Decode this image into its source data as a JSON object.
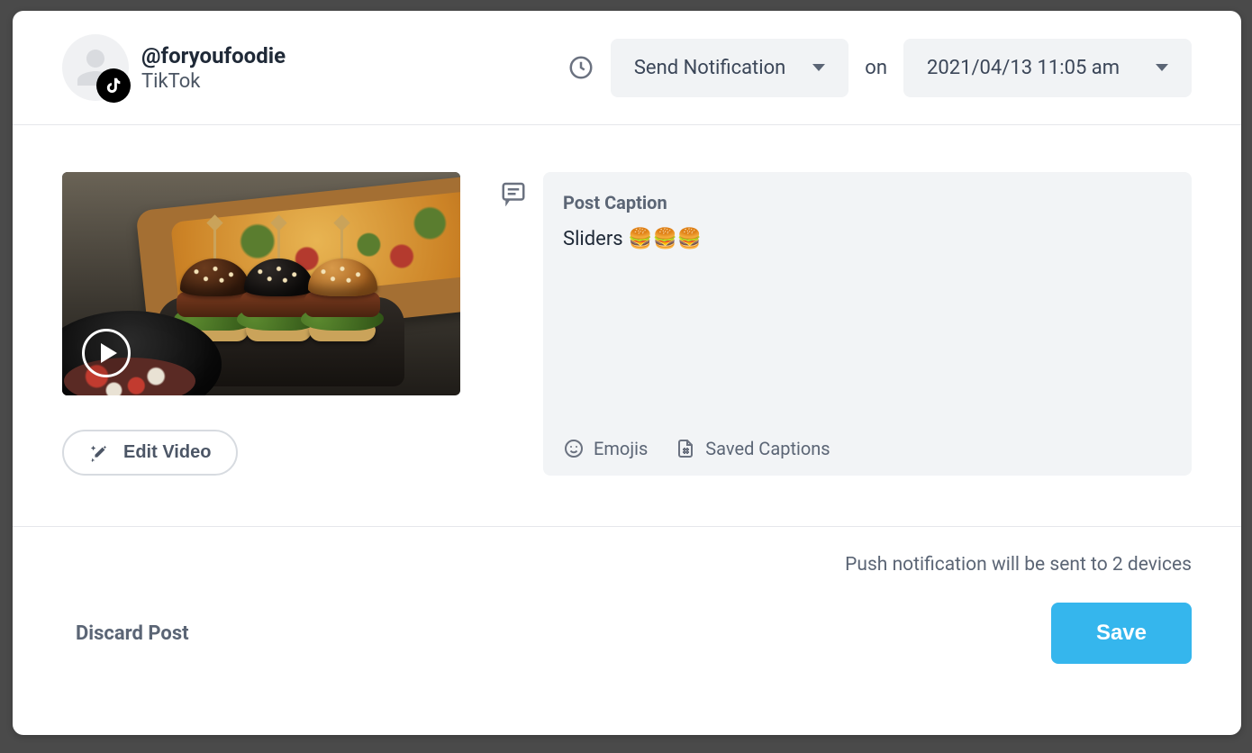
{
  "account": {
    "username": "@foryoufoodie",
    "platform": "TikTok"
  },
  "schedule": {
    "action_label": "Send Notification",
    "on_label": "on",
    "datetime_label": "2021/04/13 11:05 am"
  },
  "media": {
    "edit_video_label": "Edit Video"
  },
  "caption": {
    "title": "Post Caption",
    "text": "Sliders 🍔🍔🍔",
    "emojis_label": "Emojis",
    "saved_captions_label": "Saved Captions"
  },
  "footer": {
    "push_note": "Push notification will be sent to 2 devices",
    "discard_label": "Discard Post",
    "save_label": "Save"
  }
}
